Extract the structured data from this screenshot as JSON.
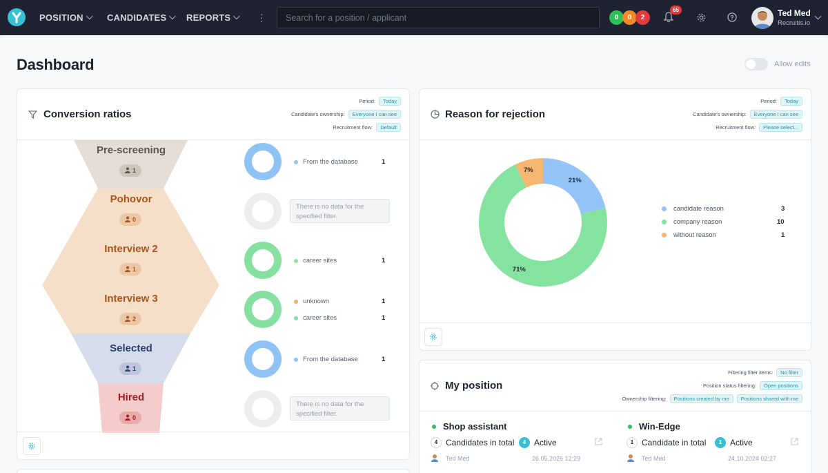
{
  "nav": {
    "items": [
      {
        "label": "POSITION"
      },
      {
        "label": "CANDIDATES"
      },
      {
        "label": "REPORTS"
      }
    ],
    "search_placeholder": "Search for a position / applicant",
    "status_pills": [
      {
        "value": "0",
        "color": "#2fbf5a"
      },
      {
        "value": "0",
        "color": "#f08a24"
      },
      {
        "value": "2",
        "color": "#e23b3b"
      }
    ],
    "notifications": "65",
    "user": {
      "name": "Ted Med",
      "company": "Recruitis.io"
    }
  },
  "page": {
    "title": "Dashboard",
    "allow_edits": "Allow edits",
    "allow_edits_on": false
  },
  "conversion": {
    "title": "Conversion ratios",
    "filters": [
      {
        "label": "Period:",
        "value": "Today"
      },
      {
        "label": "Candidate's ownership:",
        "value": "Everyone I can see"
      },
      {
        "label": "Recruitment flow:",
        "value": "Default"
      }
    ],
    "stages": [
      {
        "name": "Pre-screening",
        "count": "1",
        "color": "#5a5550",
        "fill": "#e5ddd5"
      },
      {
        "name": "Pohovor",
        "count": "0",
        "color": "#a8541a",
        "fill": "#f5dfc9"
      },
      {
        "name": "Interview 2",
        "count": "1",
        "color": "#a8541a",
        "fill": "#f5dfc9"
      },
      {
        "name": "Interview 3",
        "count": "2",
        "color": "#a8541a",
        "fill": "#f5dfc9"
      },
      {
        "name": "Selected",
        "count": "1",
        "color": "#2b3f66",
        "fill": "#d6dcec"
      },
      {
        "name": "Hired",
        "count": "0",
        "color": "#a31f1f",
        "fill": "#f4cccc"
      }
    ],
    "sources": [
      {
        "legend": [
          {
            "label": "From the database",
            "value": "1",
            "color": "#8fc3f5"
          }
        ]
      },
      {
        "nodata": "There is no data for the specified filter."
      },
      {
        "legend": [
          {
            "label": "career sites",
            "value": "1",
            "color": "#86e0a0"
          }
        ]
      },
      {
        "legend": [
          {
            "label": "unknown",
            "value": "1",
            "color": "#f5b06a"
          },
          {
            "label": "career sites",
            "value": "1",
            "color": "#86e0a0"
          }
        ]
      },
      {
        "legend": [
          {
            "label": "From the database",
            "value": "1",
            "color": "#8fc3f5"
          }
        ]
      },
      {
        "nodata": "There is no data for the specified filter."
      }
    ]
  },
  "rejection": {
    "title": "Reason for rejection",
    "filters": [
      {
        "label": "Period:",
        "value": "Today"
      },
      {
        "label": "Candidate's ownership:",
        "value": "Everyone I can see"
      },
      {
        "label": "Recruitment flow:",
        "value": "Please select..."
      }
    ]
  },
  "chart_data": {
    "type": "pie",
    "donut": true,
    "categories": [
      "candidate reason",
      "company reason",
      "without reason"
    ],
    "values": [
      3,
      10,
      1
    ],
    "percent_labels": [
      "21%",
      "71%",
      "7%"
    ],
    "colors": [
      "#94c4f7",
      "#84e39e",
      "#f7b572"
    ],
    "legend": "right"
  },
  "positions": {
    "title": "My position",
    "filters": [
      {
        "label": "Filtering filter items:",
        "values": [
          "No filter"
        ]
      },
      {
        "label": "Position status filtering:",
        "values": [
          "Open positions"
        ]
      },
      {
        "label": "Ownership filtering:",
        "values": [
          "Positions created by me",
          "Positions shared with me"
        ]
      }
    ],
    "items": [
      {
        "name": "Shop assistant",
        "candidates_count": "4",
        "candidates_label": "Candidates in total",
        "active_count": "4",
        "active_label": "Active",
        "owner": "Ted Med",
        "date": "26.05.2026 12:29"
      },
      {
        "name": "Win-Edge",
        "candidates_count": "1",
        "candidates_label": "Candidate in total",
        "active_count": "1",
        "active_label": "Active",
        "owner": "Ted Med",
        "date": "24.10.2024 02:27"
      }
    ]
  }
}
